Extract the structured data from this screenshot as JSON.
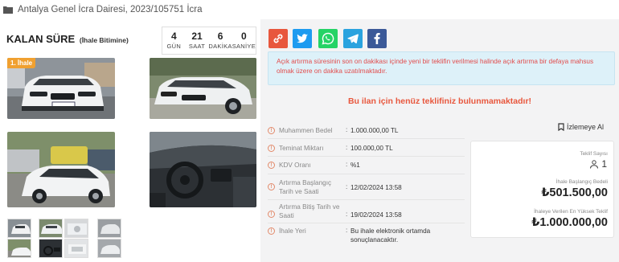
{
  "header": {
    "title": "Antalya Genel İcra Dairesi, 2023/105751 İcra"
  },
  "timer": {
    "title": "KALAN SÜRE",
    "subtitle": "(İhale Bitimine)",
    "days": "4",
    "days_label": "GÜN",
    "hours": "21",
    "hours_label": "SAAT",
    "minutes": "6",
    "minutes_label": "DAKİKA",
    "seconds": "0",
    "seconds_label": "SANİYE"
  },
  "gallery": {
    "badge": "1. İhale"
  },
  "share": [
    "link-icon",
    "twitter-icon",
    "whatsapp-icon",
    "telegram-icon",
    "facebook-icon"
  ],
  "alert": {
    "text": "Açık artırma süresinin son on dakikası içinde yeni bir teklifin verilmesi halinde açık artırma bir defaya mahsus olmak üzere on dakika uzatılmaktadır."
  },
  "no_offer": "Bu ilan için henüz teklifiniz bulunmamaktadır!",
  "details": {
    "appraised_label": "Muhammen Bedel",
    "appraised_value": "1.000.000,00 TL",
    "deposit_label": "Teminat Miktarı",
    "deposit_value": "100.000,00 TL",
    "vat_label": "KDV Oranı",
    "vat_value": "%1",
    "start_label_1": "Artırma Başlangıç",
    "start_label_2": "Tarih ve Saati",
    "start_value": "12/02/2024 13:58",
    "end_label_1": "Artırma Bitiş Tarih ve",
    "end_label_2": "Saati",
    "end_value": "19/02/2024 13:58",
    "place_label": "İhale Yeri",
    "place_value_1": "Bu ihale elektronik ortamda",
    "place_value_2": "sonuçlanacaktır."
  },
  "watch": {
    "label": "İzlemeye Al"
  },
  "summary": {
    "bids_label": "Teklif Sayısı",
    "bids_value": "1",
    "start_price_label": "İhale Başlangıç Bedeli",
    "start_price_value": "₺501.500,00",
    "highest_label": "İhaleye Verilen En Yüksek Teklif",
    "highest_value": "₺1.000.000,00"
  },
  "colors": {
    "accent": "#e8573d",
    "alert_bg": "#ddf1f9",
    "alert_text": "#e24b4b"
  }
}
